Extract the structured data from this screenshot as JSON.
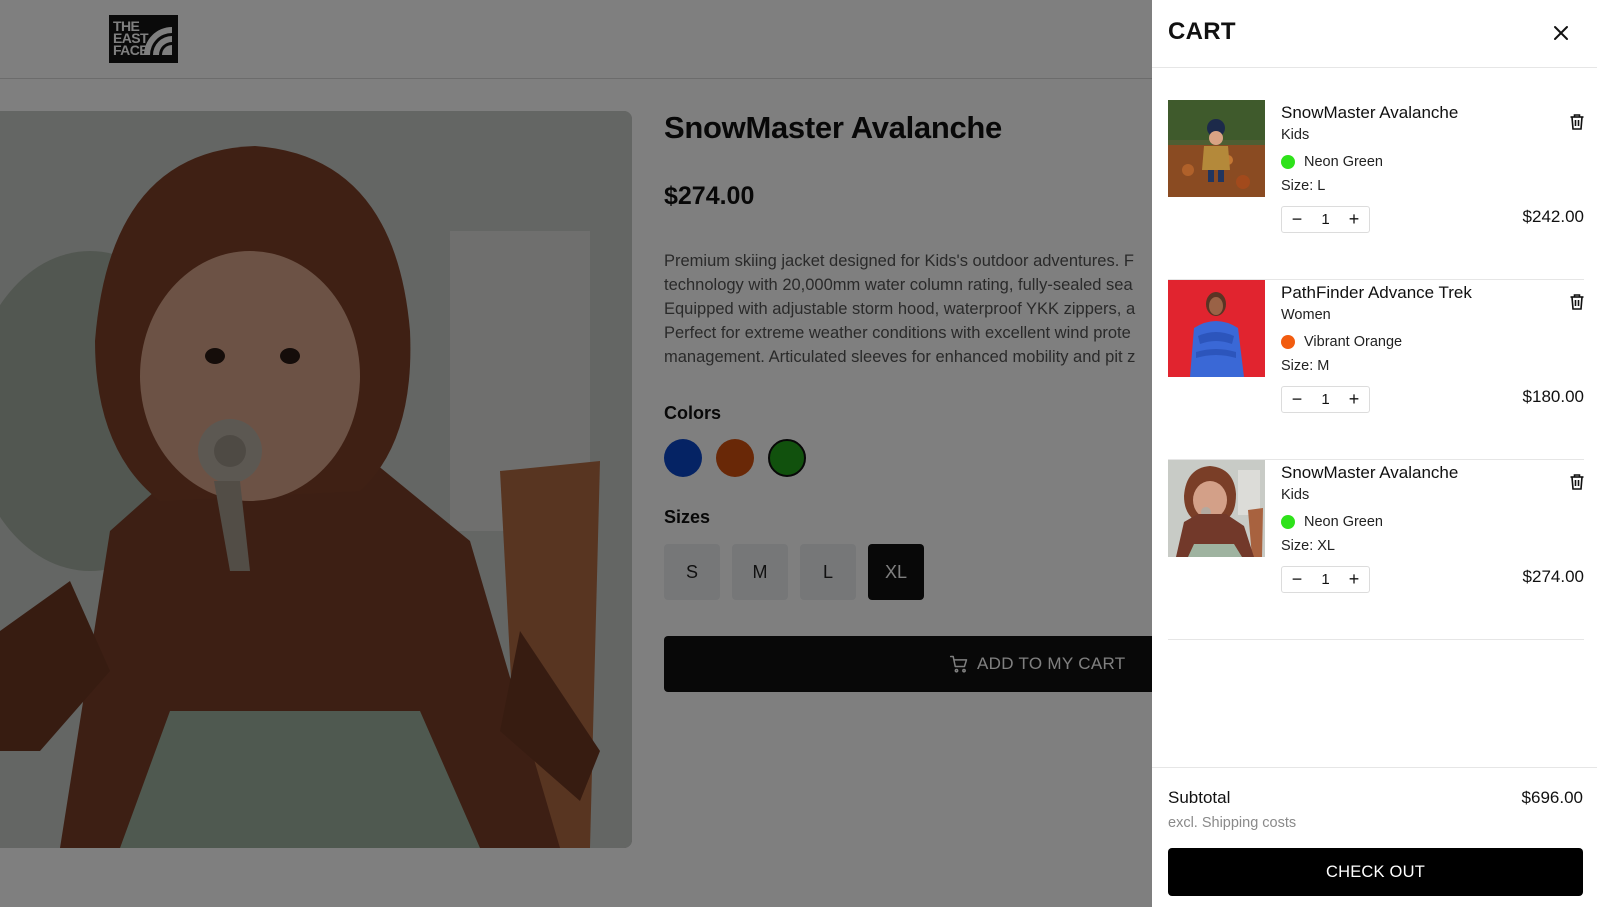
{
  "brand": {
    "logo_lines": [
      "THE",
      "EAST",
      "FACE"
    ]
  },
  "product": {
    "title": "SnowMaster Avalanche",
    "price": "$274.00",
    "description_lines": [
      "Premium skiing jacket designed for Kids's outdoor adventures. F",
      "technology with 20,000mm water column rating, fully-sealed sea",
      "Equipped with adjustable storm hood, waterproof YKK zippers, a",
      "Perfect for extreme weather conditions with excellent wind prote",
      "management. Articulated sleeves for enhanced mobility and pit z"
    ],
    "colors_label": "Colors",
    "colors": [
      "#0a47c9",
      "#d2500e",
      "#22a21a"
    ],
    "selected_color_index": 2,
    "sizes_label": "Sizes",
    "sizes": [
      "S",
      "M",
      "L",
      "XL"
    ],
    "selected_size": "XL",
    "add_to_cart_label": "ADD TO MY CART"
  },
  "cart": {
    "title": "CART",
    "items": [
      {
        "name": "SnowMaster Avalanche",
        "category": "Kids",
        "color_name": "Neon Green",
        "color_hex": "#2ee21a",
        "size": "Size: L",
        "quantity": "1",
        "price": "$242.00"
      },
      {
        "name": "PathFinder Advance Trek",
        "category": "Women",
        "color_name": "Vibrant Orange",
        "color_hex": "#f25c0f",
        "size": "Size: M",
        "quantity": "1",
        "price": "$180.00"
      },
      {
        "name": "SnowMaster Avalanche",
        "category": "Kids",
        "color_name": "Neon Green",
        "color_hex": "#2ee21a",
        "size": "Size: XL",
        "quantity": "1",
        "price": "$274.00"
      }
    ],
    "subtotal_label": "Subtotal",
    "subtotal_value": "$696.00",
    "shipping_note": "excl. Shipping costs",
    "checkout_label": "CHECK OUT"
  }
}
